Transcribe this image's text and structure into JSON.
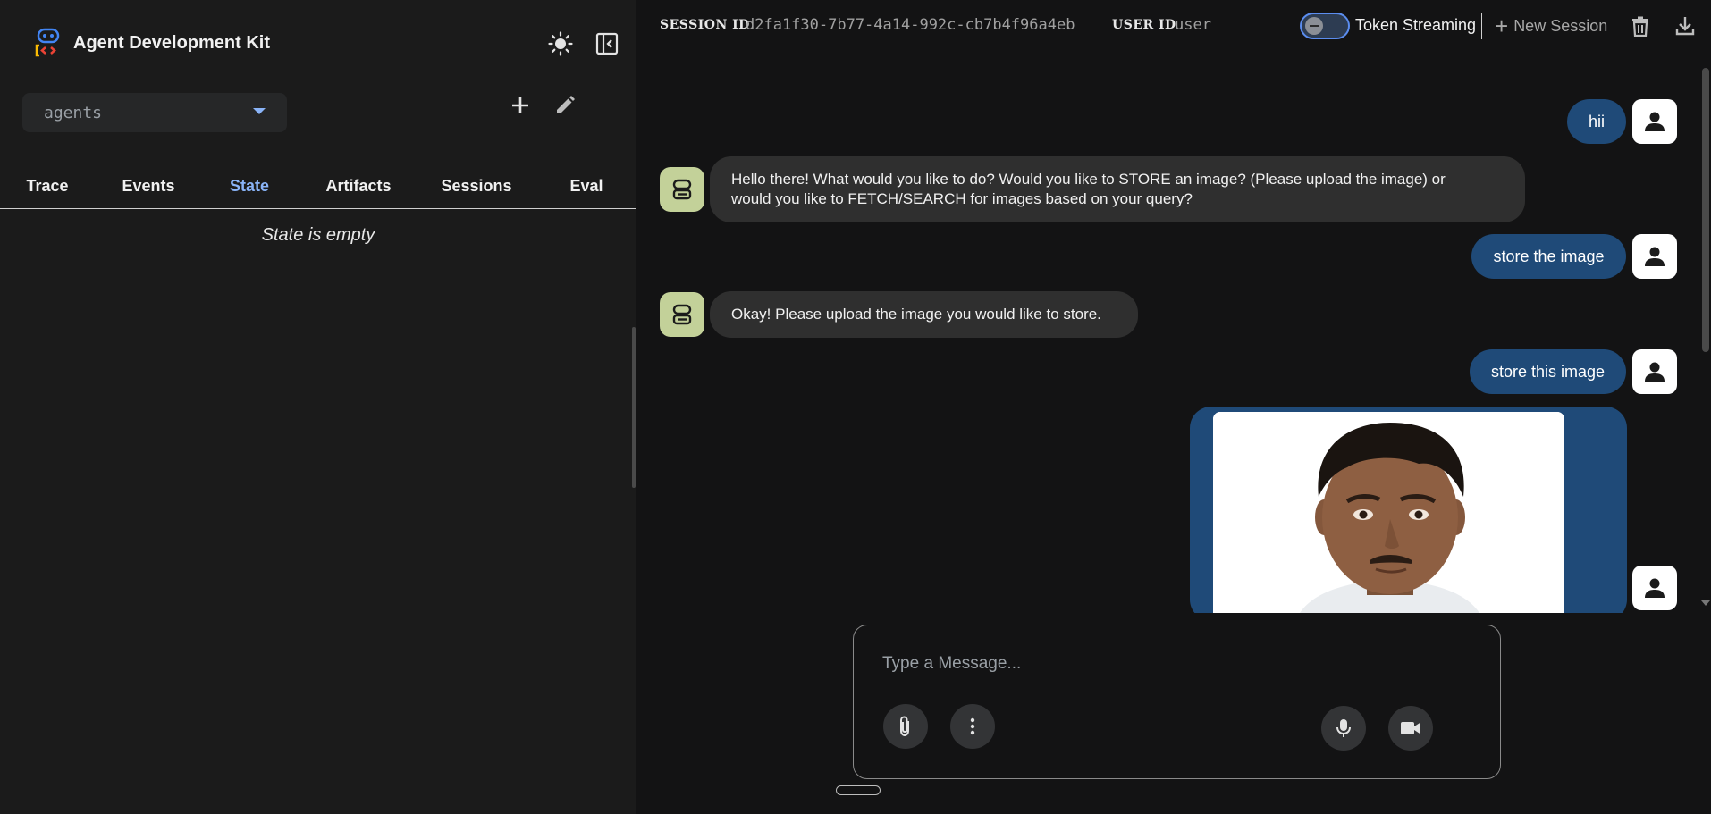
{
  "app": {
    "title": "Agent Development Kit"
  },
  "agent_selector": {
    "value": "agents"
  },
  "tabs": [
    {
      "label": "Trace"
    },
    {
      "label": "Events"
    },
    {
      "label": "State",
      "active": true
    },
    {
      "label": "Artifacts"
    },
    {
      "label": "Sessions"
    },
    {
      "label": "Eval"
    }
  ],
  "state_panel": {
    "empty_text": "State is empty"
  },
  "topbar": {
    "session_label": "SESSION ID",
    "session_id": "d2fa1f30-7b77-4a14-992c-cb7b4f96a4eb",
    "user_label": "USER ID",
    "user_id": "user",
    "token_streaming_label": "Token Streaming",
    "token_streaming_on": false,
    "new_session_label": "New Session"
  },
  "messages": [
    {
      "role": "user",
      "text": "hii"
    },
    {
      "role": "bot",
      "lines": [
        "Hello there! What would you like to do? Would you like to STORE an image? (Please upload the image) or",
        "would you like to FETCH/SEARCH for images based on your query?"
      ]
    },
    {
      "role": "user",
      "text": "store the image"
    },
    {
      "role": "bot",
      "lines": [
        "Okay! Please upload the image you would like to store."
      ]
    },
    {
      "role": "user",
      "text": "store this image"
    },
    {
      "role": "user",
      "type": "image",
      "image": "portrait-photo"
    }
  ],
  "input": {
    "placeholder": "Type a Message..."
  },
  "colors": {
    "accent": "#8ab4f8",
    "user_bubble": "#1f4a78",
    "bot_bubble": "#2f2f2f",
    "bot_avatar": "#c3d199",
    "panel_bg": "#1b1b1b",
    "chat_bg": "#131314"
  },
  "icons": {
    "theme": "sun-icon",
    "collapse": "left-panel-icon",
    "add": "plus-icon",
    "edit": "pencil-icon",
    "delete": "trash-icon",
    "download": "download-icon",
    "attach": "paperclip-icon",
    "more": "more-vert-icon",
    "mic": "mic-icon",
    "video": "videocam-icon"
  }
}
